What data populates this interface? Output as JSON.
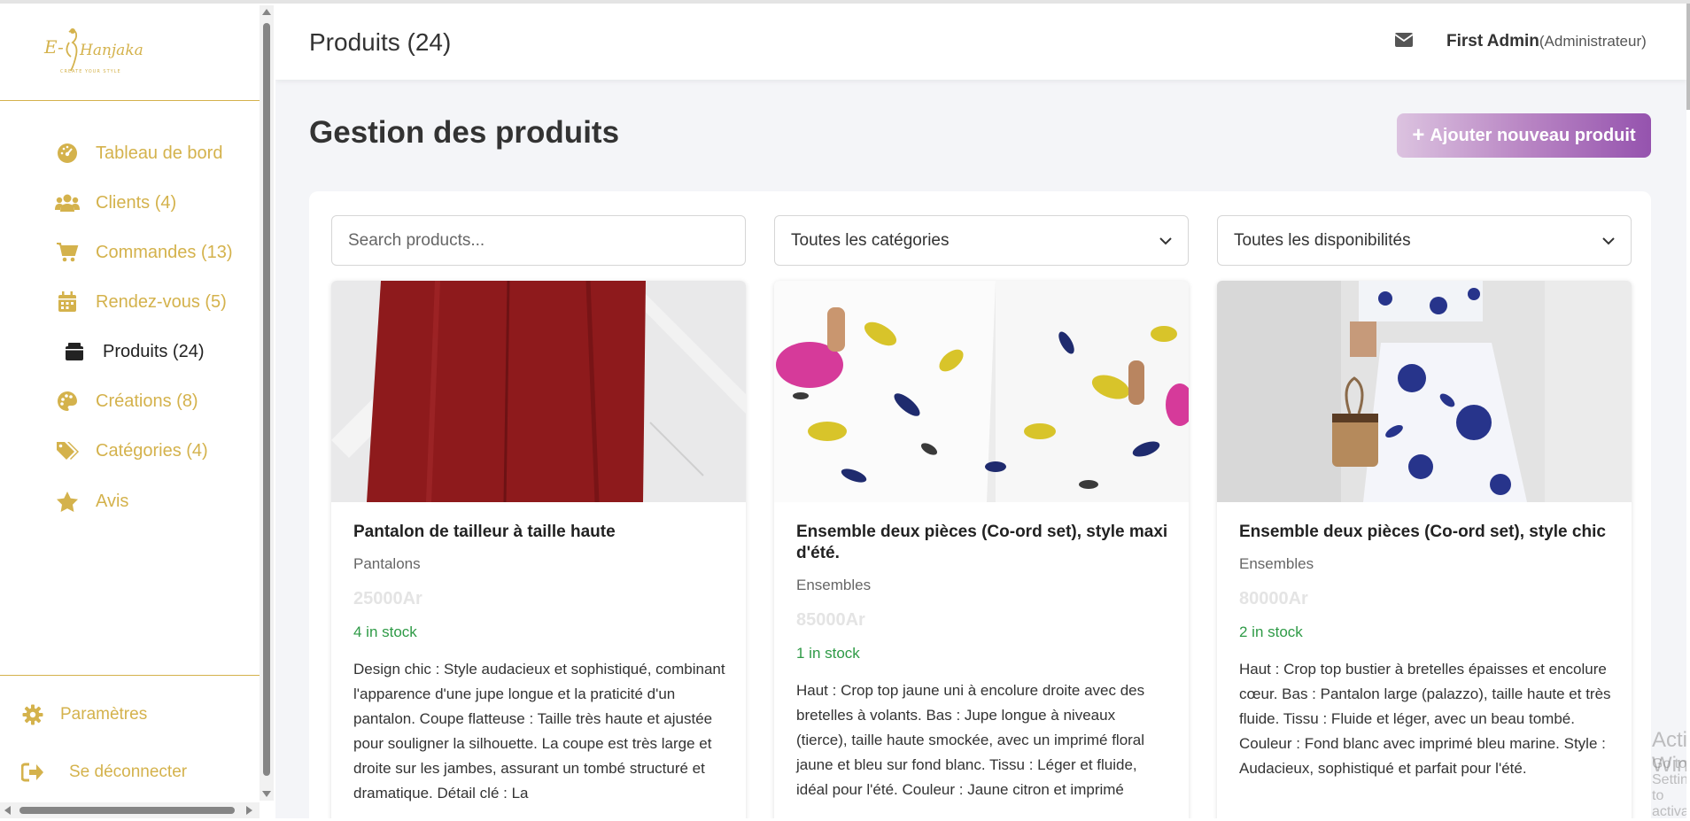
{
  "brand": {
    "logo_text": "E- Hanjaka",
    "logo_tagline": "CREATE YOUR STYLE"
  },
  "sidebar": {
    "items": [
      {
        "label": "Tableau de bord",
        "icon": "palette-dashboard-icon"
      },
      {
        "label": "Clients (4)",
        "icon": "users-icon"
      },
      {
        "label": "Commandes (13)",
        "icon": "cart-icon"
      },
      {
        "label": "Rendez-vous (5)",
        "icon": "calendar-icon"
      },
      {
        "label": "Produits (24)",
        "icon": "box-icon",
        "active": true
      },
      {
        "label": "Créations (8)",
        "icon": "palette-icon"
      },
      {
        "label": "Catégories (4)",
        "icon": "tags-icon"
      },
      {
        "label": "Avis",
        "icon": "star-icon"
      }
    ],
    "settings_label": "Paramètres",
    "logout_label": "Se déconnecter"
  },
  "header": {
    "title": "Produits (24)",
    "user_name": "First Admin",
    "user_role": "(Administrateur)"
  },
  "page": {
    "title": "Gestion des produits",
    "add_button": "Ajouter nouveau produit"
  },
  "filters": {
    "search_placeholder": "Search products...",
    "category_selected": "Toutes les catégories",
    "availability_selected": "Toutes les disponibilités"
  },
  "products": [
    {
      "title": "Pantalon de tailleur à taille haute",
      "category": "Pantalons",
      "price": "25000Ar",
      "stock": "4 in stock",
      "description": "Design chic : Style audacieux et sophistiqué, combinant l'apparence d'une jupe longue et la praticité d'un pantalon. Coupe flatteuse : Taille très haute et ajustée pour souligner la silhouette. La coupe est très large et droite sur les jambes, assurant un tombé structuré et dramatique. Détail clé : La"
    },
    {
      "title": "Ensemble deux pièces (Co-ord set), style maxi d'été.",
      "category": "Ensembles",
      "price": "85000Ar",
      "stock": "1 in stock",
      "description": "Haut : Crop top jaune uni à encolure droite avec des bretelles à volants. Bas : Jupe longue à niveaux (tierce), taille haute smockée, avec un imprimé floral jaune et bleu sur fond blanc. Tissu : Léger et fluide, idéal pour l'été. Couleur : Jaune citron et imprimé"
    },
    {
      "title": "Ensemble deux pièces (Co-ord set), style chic",
      "category": "Ensembles",
      "price": "80000Ar",
      "stock": "2 in stock",
      "description": "Haut : Crop top bustier à bretelles épaisses et encolure cœur. Bas : Pantalon large (palazzo), taille haute et très fluide. Tissu : Fluide et léger, avec un beau tombé. Couleur : Fond blanc avec imprimé bleu marine. Style : Audacieux, sophistiqué et parfait pour l'été."
    }
  ],
  "watermark": {
    "line1": "Activate Windows",
    "line2": "Go to Settings to activate Windows."
  },
  "colors": {
    "gold": "#d4b24c",
    "purple_start": "#dcc3e0",
    "purple_end": "#9553ae",
    "stock_green": "#2e9a46",
    "background": "#f4f5f8"
  }
}
